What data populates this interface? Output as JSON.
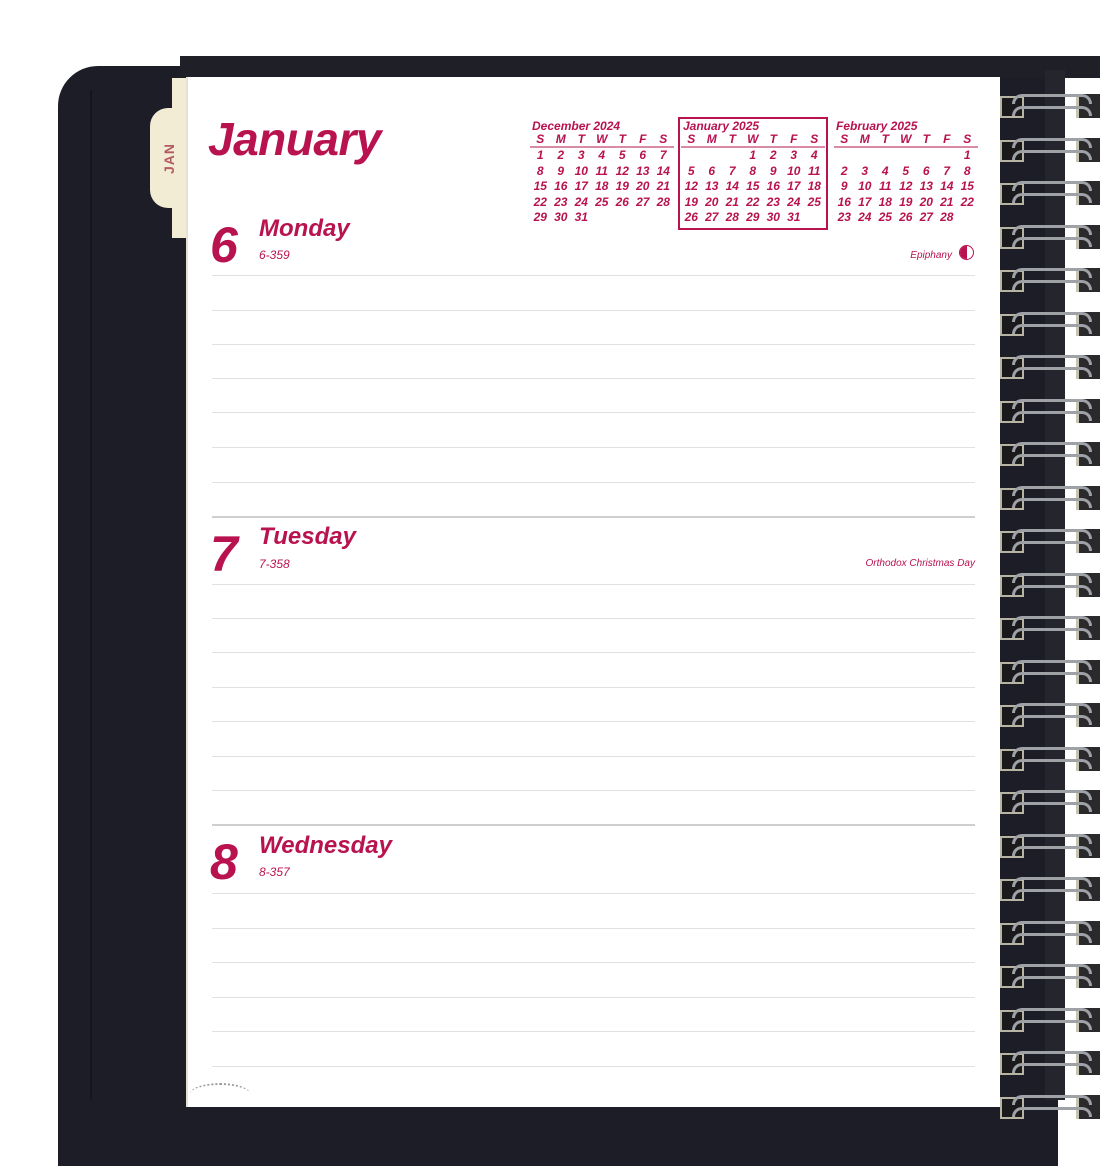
{
  "tab": {
    "label": "JAN"
  },
  "month_title": "January",
  "mini_calendars": [
    {
      "title": "December 2024",
      "current": false,
      "weekdays": [
        "S",
        "M",
        "T",
        "W",
        "T",
        "F",
        "S"
      ],
      "weeks": [
        [
          "1",
          "2",
          "3",
          "4",
          "5",
          "6",
          "7"
        ],
        [
          "8",
          "9",
          "10",
          "11",
          "12",
          "13",
          "14"
        ],
        [
          "15",
          "16",
          "17",
          "18",
          "19",
          "20",
          "21"
        ],
        [
          "22",
          "23",
          "24",
          "25",
          "26",
          "27",
          "28"
        ],
        [
          "29",
          "30",
          "31",
          "",
          "",
          "",
          ""
        ]
      ]
    },
    {
      "title": "January 2025",
      "current": true,
      "weekdays": [
        "S",
        "M",
        "T",
        "W",
        "T",
        "F",
        "S"
      ],
      "weeks": [
        [
          "",
          "",
          "",
          "1",
          "2",
          "3",
          "4"
        ],
        [
          "5",
          "6",
          "7",
          "8",
          "9",
          "10",
          "11"
        ],
        [
          "12",
          "13",
          "14",
          "15",
          "16",
          "17",
          "18"
        ],
        [
          "19",
          "20",
          "21",
          "22",
          "23",
          "24",
          "25"
        ],
        [
          "26",
          "27",
          "28",
          "29",
          "30",
          "31",
          ""
        ]
      ]
    },
    {
      "title": "February 2025",
      "current": false,
      "weekdays": [
        "S",
        "M",
        "T",
        "W",
        "T",
        "F",
        "S"
      ],
      "weeks": [
        [
          "",
          "",
          "",
          "",
          "",
          "",
          "1"
        ],
        [
          "2",
          "3",
          "4",
          "5",
          "6",
          "7",
          "8"
        ],
        [
          "9",
          "10",
          "11",
          "12",
          "13",
          "14",
          "15"
        ],
        [
          "16",
          "17",
          "18",
          "19",
          "20",
          "21",
          "22"
        ],
        [
          "23",
          "24",
          "25",
          "26",
          "27",
          "28",
          ""
        ]
      ]
    }
  ],
  "days": [
    {
      "number": "6",
      "name": "Monday",
      "count": "6-359",
      "holiday": "Epiphany",
      "moon_icon": "first-quarter-moon"
    },
    {
      "number": "7",
      "name": "Tuesday",
      "count": "7-358",
      "holiday": "Orthodox Christmas Day"
    },
    {
      "number": "8",
      "name": "Wednesday",
      "count": "8-357",
      "holiday": ""
    }
  ],
  "colors": {
    "accent": "#b8124f",
    "cover": "#1c1d26",
    "tab": "#f3ecd4"
  }
}
